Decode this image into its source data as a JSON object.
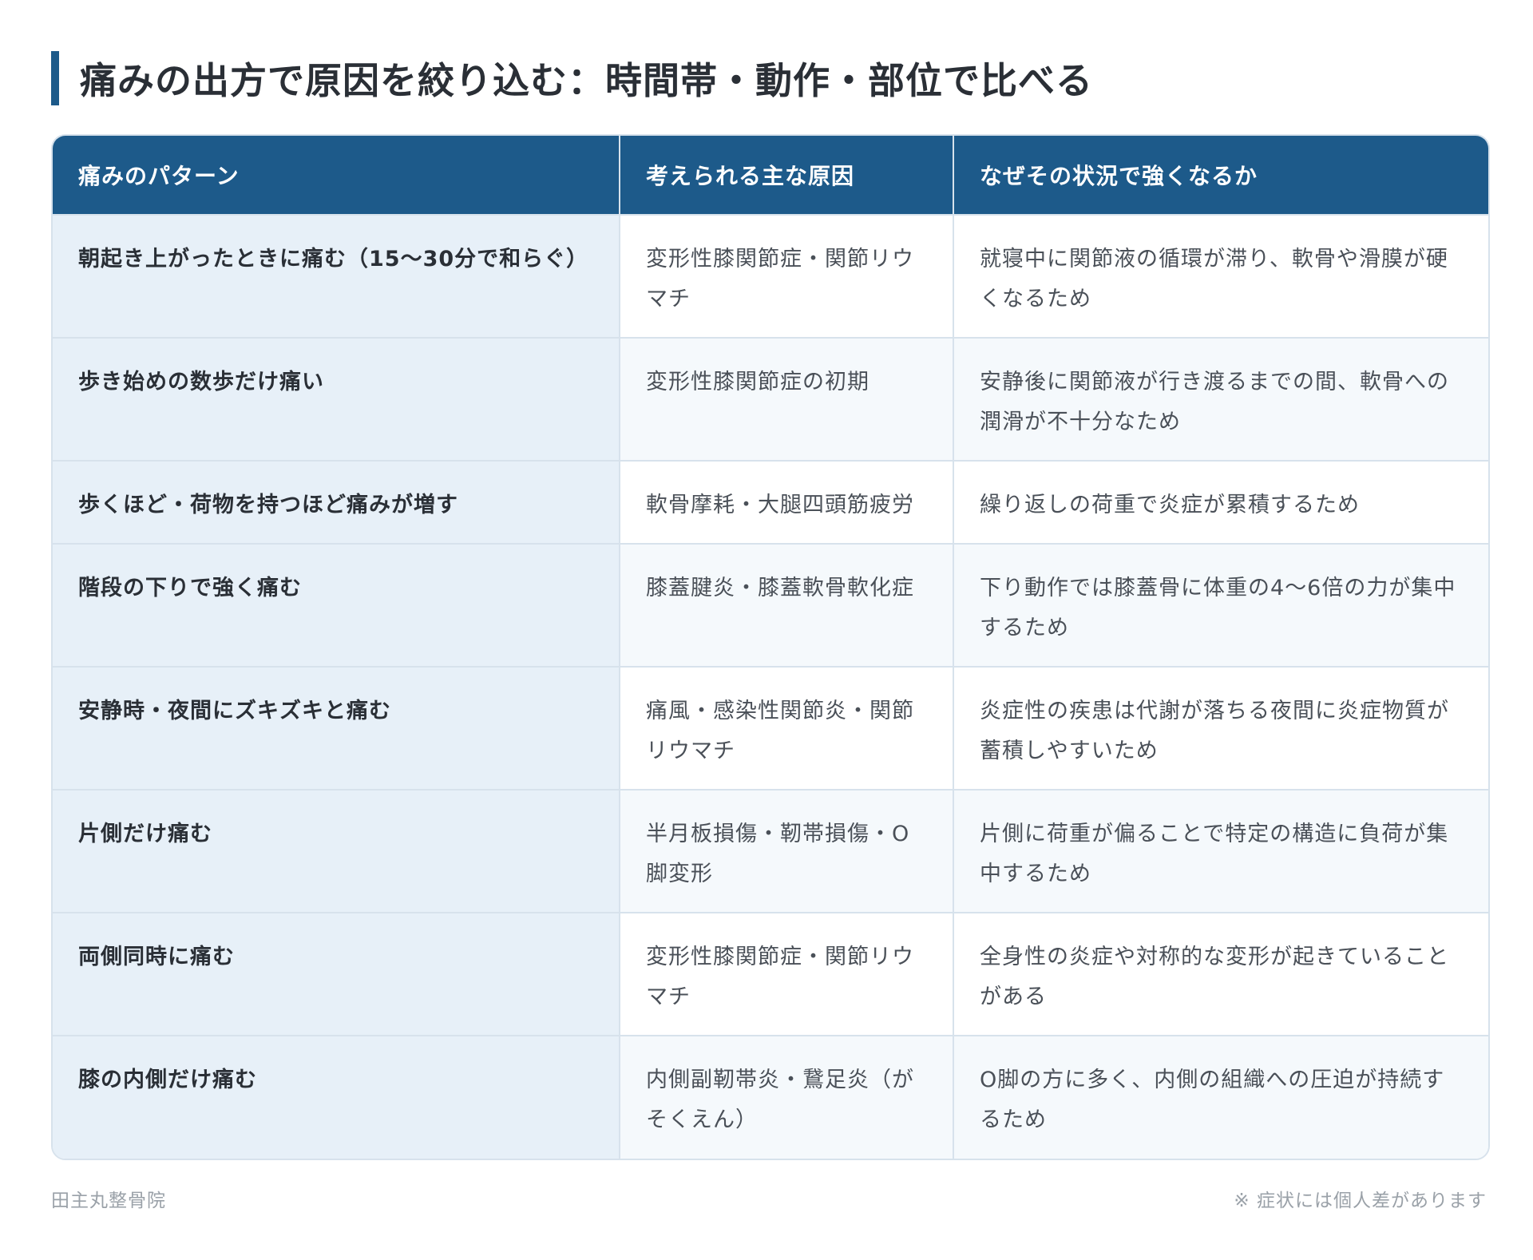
{
  "title": "痛みの出方で原因を絞り込む：時間帯・動作・部位で比べる",
  "table": {
    "headers": [
      "痛みのパターン",
      "考えられる主な原因",
      "なぜその状況で強くなるか"
    ],
    "rows": [
      [
        "朝起き上がったときに痛む（15〜30分で和らぐ）",
        "変形性膝関節症・関節リウマチ",
        "就寝中に関節液の循環が滞り、軟骨や滑膜が硬くなるため"
      ],
      [
        "歩き始めの数歩だけ痛い",
        "変形性膝関節症の初期",
        "安静後に関節液が行き渡るまでの間、軟骨への潤滑が不十分なため"
      ],
      [
        "歩くほど・荷物を持つほど痛みが増す",
        "軟骨摩耗・大腿四頭筋疲労",
        "繰り返しの荷重で炎症が累積するため"
      ],
      [
        "階段の下りで強く痛む",
        "膝蓋腱炎・膝蓋軟骨軟化症",
        "下り動作では膝蓋骨に体重の4〜6倍の力が集中するため"
      ],
      [
        "安静時・夜間にズキズキと痛む",
        "痛風・感染性関節炎・関節リウマチ",
        "炎症性の疾患は代謝が落ちる夜間に炎症物質が蓄積しやすいため"
      ],
      [
        "片側だけ痛む",
        "半月板損傷・靭帯損傷・O脚変形",
        "片側に荷重が偏ることで特定の構造に負荷が集中するため"
      ],
      [
        "両側同時に痛む",
        "変形性膝関節症・関節リウマチ",
        "全身性の炎症や対称的な変形が起きていることがある"
      ],
      [
        "膝の内側だけ痛む",
        "内側副靭帯炎・鵞足炎（がそくえん）",
        "O脚の方に多く、内側の組織への圧迫が持続するため"
      ]
    ]
  },
  "footer": {
    "left": "田主丸整骨院",
    "right": "※ 症状には個人差があります"
  }
}
